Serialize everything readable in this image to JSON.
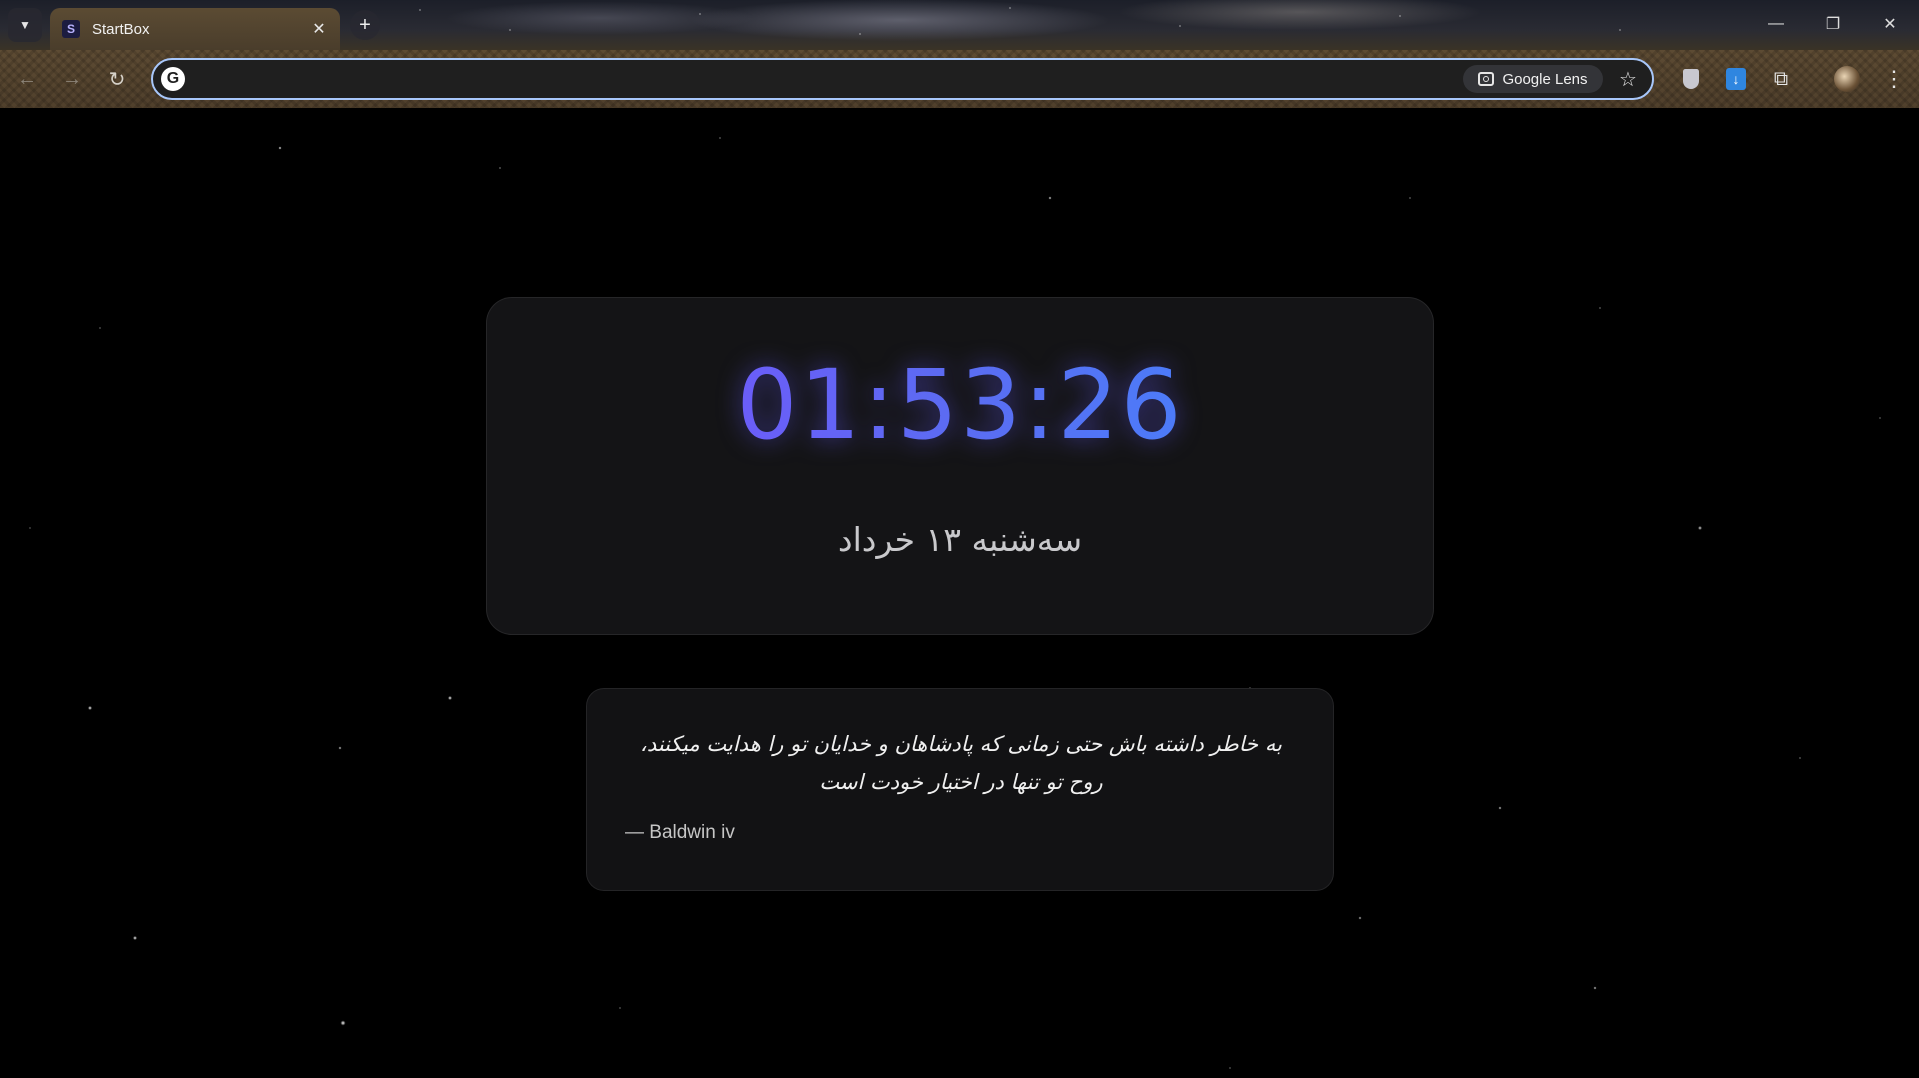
{
  "browser": {
    "tab": {
      "title": "StartBox",
      "favicon": "S"
    },
    "new_tab_symbol": "+",
    "omnibox": {
      "value": "",
      "placeholder": "",
      "google_icon": "G",
      "lens_label": "Google Lens"
    },
    "icons": {
      "tab_search": "chevron-down-icon",
      "tab_close": "close-icon",
      "back": "arrow-left-icon",
      "forward": "arrow-right-icon",
      "reload": "reload-icon",
      "bookmark": "star-icon",
      "extension_shield": "shield-icon",
      "extension_download": "download-icon",
      "extensions": "puzzle-icon",
      "profile": "avatar",
      "menu": "kebab-menu-icon"
    }
  },
  "clock": {
    "time": "01:53:26",
    "date": "سه‌شنبه ۱۳ خرداد",
    "gradient": [
      "#7c4dff",
      "#3b8cff"
    ]
  },
  "quote": {
    "text": "به خاطر داشته باش حتی زمانی که پادشاهان و خدایان تو را هدایت میکنند، روح تو تنها در اختیار خودت است",
    "author": "— Baldwin iv"
  },
  "colors": {
    "omnibox_focus": "#a8c7fa",
    "card_bg": "#161618",
    "page_bg": "#000000"
  }
}
